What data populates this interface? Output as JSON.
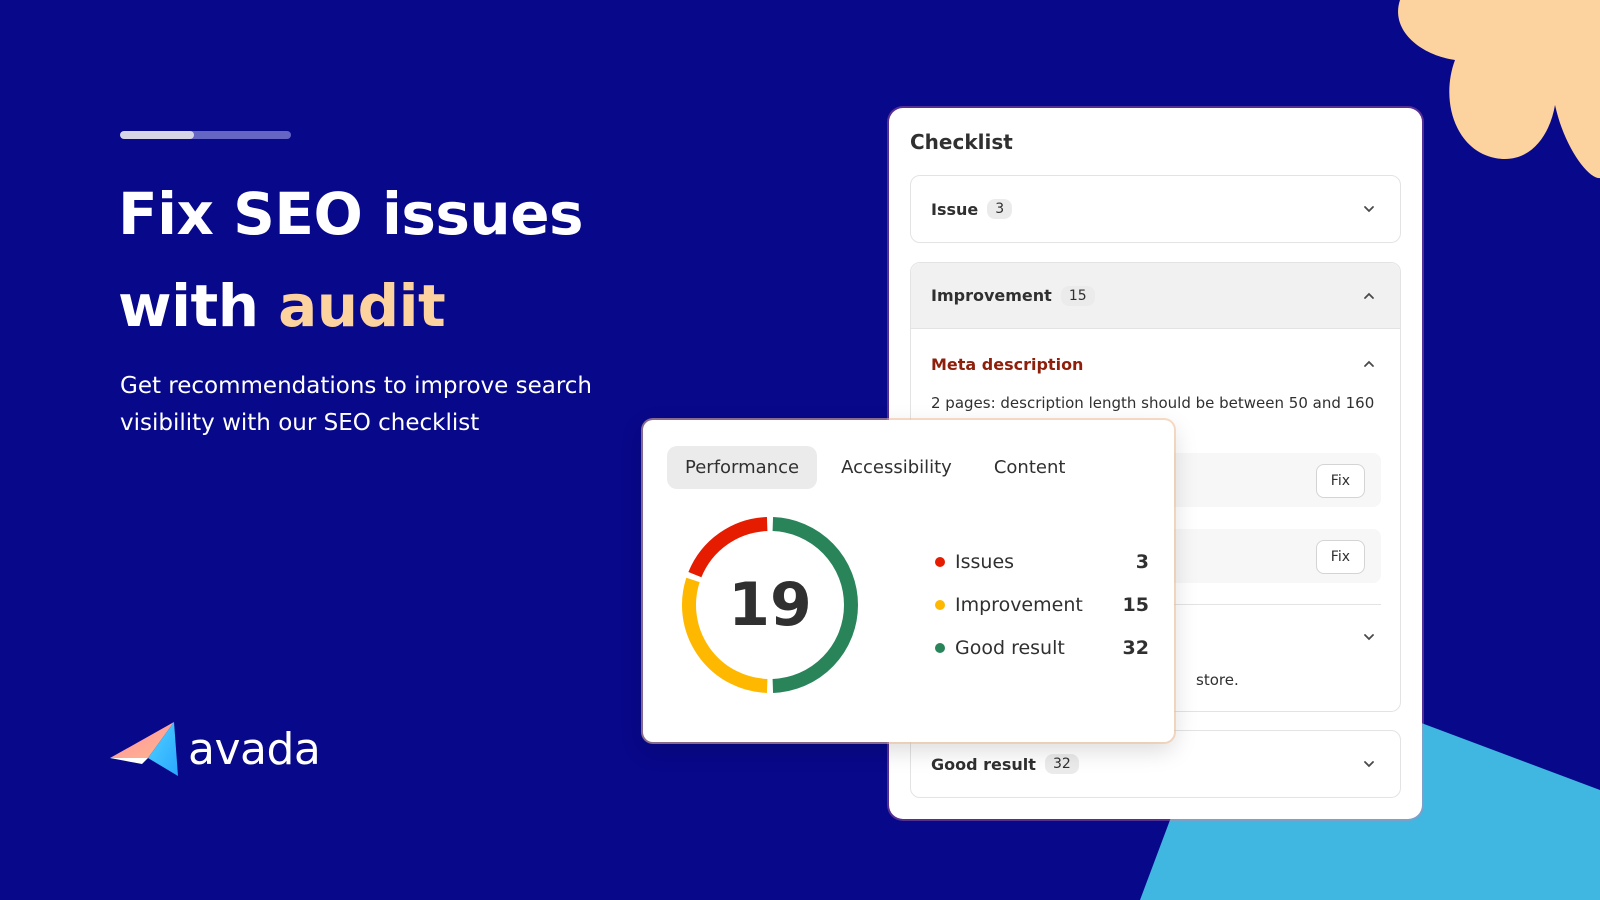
{
  "hero": {
    "progress": 0.43,
    "title_line1": "Fix SEO issues",
    "title_line2_prefix": "with ",
    "title_line2_accent": "audit",
    "subtitle": "Get recommendations to improve search visibility with our SEO checklist"
  },
  "brand": {
    "name": "avada"
  },
  "checklist": {
    "title": "Checklist",
    "issue": {
      "label": "Issue",
      "count": "3"
    },
    "improvement": {
      "label": "Improvement",
      "count": "15",
      "meta_title": "Meta description",
      "meta_desc": "2 pages: description length should be between 50 and 160 characters",
      "fix_label": "Fix",
      "store_text": "store."
    },
    "good": {
      "label": "Good result",
      "count": "32"
    }
  },
  "score": {
    "tabs": [
      "Performance",
      "Accessibility",
      "Content"
    ],
    "active_tab": 0,
    "total": "19",
    "legend": [
      {
        "label": "Issues",
        "value": "3",
        "color": "#e51c00"
      },
      {
        "label": "Improvement",
        "value": "15",
        "color": "#ffb800"
      },
      {
        "label": "Good result",
        "value": "32",
        "color": "#29845a"
      }
    ]
  },
  "colors": {
    "background": "#08088a",
    "accent": "#fcd29f",
    "blob_blue": "#3fb7e0"
  }
}
